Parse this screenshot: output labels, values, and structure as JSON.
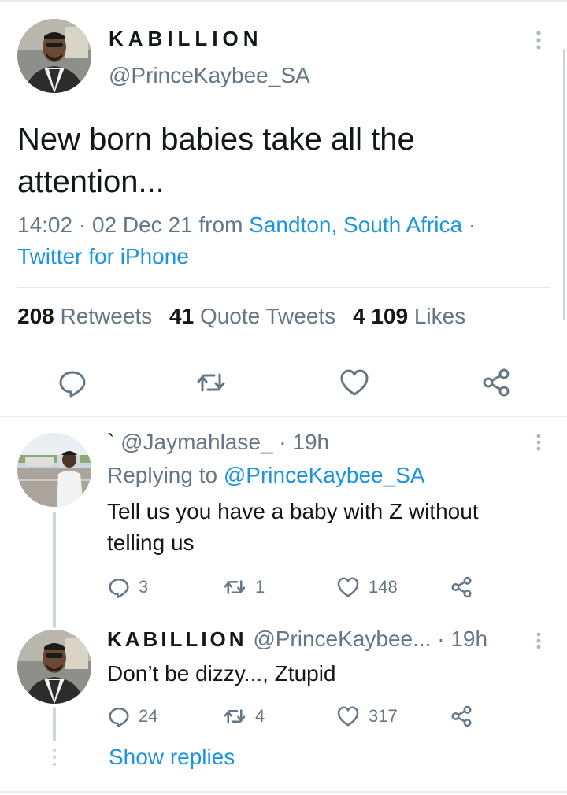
{
  "main_tweet": {
    "author_name": "KABILLION",
    "author_handle": "@PrinceKaybee_SA",
    "text": "New born babies take all the attention...",
    "time": "14:02",
    "date": "02 Dec 21",
    "from_word": "from",
    "location": "Sandton, South Africa",
    "client": "Twitter for iPhone",
    "retweets_count": "208",
    "retweets_label": "Retweets",
    "quotes_count": "41",
    "quotes_label": "Quote Tweets",
    "likes_count": "4 109",
    "likes_label": "Likes"
  },
  "replies": [
    {
      "prefix": "`",
      "handle": "@Jaymahlase_",
      "time": "19h",
      "replying_to_label": "Replying to",
      "replying_to_handle": "@PrinceKaybee_SA",
      "text": "Tell us you have a baby with Z without telling us",
      "reply_count": "3",
      "retweet_count": "1",
      "like_count": "148"
    },
    {
      "name": "KABILLION",
      "handle": "@PrinceKaybee...",
      "time": "19h",
      "text": "Don’t be dizzy..., Ztupid",
      "reply_count": "24",
      "retweet_count": "4",
      "like_count": "317"
    }
  ],
  "show_replies_label": "Show replies",
  "icons": [
    "reply-icon",
    "retweet-icon",
    "like-icon",
    "share-icon",
    "more-icon"
  ],
  "colors": {
    "link": "#1b95e0",
    "secondary": "#657786",
    "primary": "#14171a"
  }
}
